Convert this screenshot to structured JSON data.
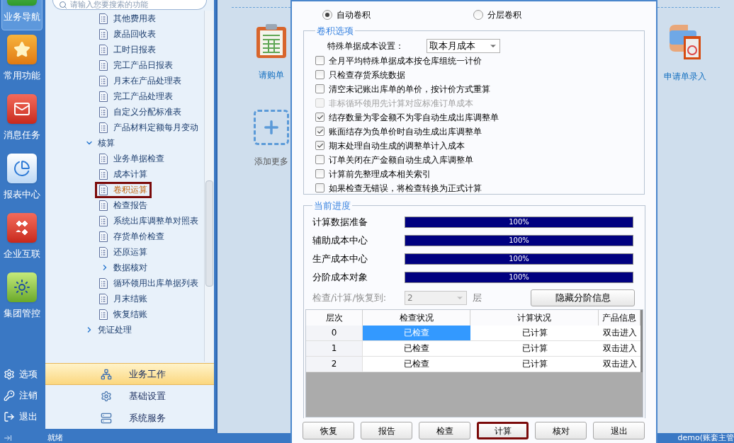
{
  "rail": {
    "items": [
      {
        "label": "业务导航",
        "selected": true,
        "kind": "nav"
      },
      {
        "label": "常用功能",
        "selected": false,
        "kind": "star"
      },
      {
        "label": "消息任务",
        "selected": false,
        "kind": "mail"
      },
      {
        "label": "报表中心",
        "selected": false,
        "kind": "report"
      },
      {
        "label": "企业互联",
        "selected": false,
        "kind": "diamond"
      },
      {
        "label": "集团管控",
        "selected": false,
        "kind": "sun"
      }
    ],
    "bottom": [
      {
        "label": "选项",
        "kind": "gear"
      },
      {
        "label": "注销",
        "kind": "key"
      },
      {
        "label": "退出",
        "kind": "exit"
      }
    ]
  },
  "search": {
    "placeholder": "请输入您要搜索的功能"
  },
  "tree": [
    {
      "kind": "group",
      "children": [
        {
          "kind": "leaf",
          "label": "其他费用表",
          "selected": false
        },
        {
          "kind": "leaf",
          "label": "废品回收表",
          "selected": false
        },
        {
          "kind": "leaf",
          "label": "工时日报表",
          "selected": false
        },
        {
          "kind": "leaf",
          "label": "完工产品日报表",
          "selected": false
        },
        {
          "kind": "leaf",
          "label": "月末在产品处理表",
          "selected": false
        },
        {
          "kind": "leaf",
          "label": "完工产品处理表",
          "selected": false
        },
        {
          "kind": "leaf",
          "label": "自定义分配标准表",
          "selected": false
        },
        {
          "kind": "leaf",
          "label": "产品材料定额每月变动",
          "selected": false
        }
      ]
    },
    {
      "kind": "folder",
      "label": "核算",
      "expanded": true,
      "children": [
        {
          "kind": "leaf",
          "label": "业务单据检查",
          "selected": false
        },
        {
          "kind": "leaf",
          "label": "成本计算",
          "selected": false
        },
        {
          "kind": "leaf",
          "label": "卷积运算",
          "selected": true
        },
        {
          "kind": "leaf",
          "label": "检查报告",
          "selected": false
        },
        {
          "kind": "leaf",
          "label": "系统出库调整单对照表",
          "selected": false
        },
        {
          "kind": "leaf",
          "label": "存货单价检查",
          "selected": false
        },
        {
          "kind": "leaf",
          "label": "还原运算",
          "selected": false
        },
        {
          "kind": "folder",
          "label": "数据核对",
          "expanded": false
        },
        {
          "kind": "leaf",
          "label": "循环领用出库单据列表",
          "selected": false
        },
        {
          "kind": "leaf",
          "label": "月末结账",
          "selected": false
        },
        {
          "kind": "leaf",
          "label": "恢复结账",
          "selected": false
        }
      ]
    },
    {
      "kind": "folder",
      "label": "凭证处理",
      "expanded": false
    }
  ],
  "nav_sections": [
    {
      "label": "业务工作",
      "selected": true,
      "kind": "work"
    },
    {
      "label": "基础设置",
      "selected": false,
      "kind": "gear"
    },
    {
      "label": "系统服务",
      "selected": false,
      "kind": "server"
    }
  ],
  "shortcuts": [
    {
      "label": "请购单",
      "kind": "clipboard"
    },
    {
      "label": "添加更多",
      "kind": "add"
    },
    {
      "label": "申请单录入",
      "kind": "hand"
    }
  ],
  "dialog": {
    "modes": [
      {
        "label": "自动卷积",
        "selected": true
      },
      {
        "label": "分层卷积",
        "selected": false
      }
    ],
    "options_group": {
      "title": "卷积选项",
      "setting_label": "特殊单据成本设置：",
      "setting_value": "取本月成本",
      "options": [
        {
          "label": "全月平均特殊单据成本按仓库组统一计价",
          "checked": false,
          "disabled": false
        },
        {
          "label": "只检查存货系统数据",
          "checked": false,
          "disabled": false
        },
        {
          "label": "清空未记账出库单的单价，按计价方式重算",
          "checked": false,
          "disabled": false
        },
        {
          "label": "非标循环领用先计算对应标准订单成本",
          "checked": false,
          "disabled": true
        },
        {
          "label": "结存数量为零金额不为零自动生成出库调整单",
          "checked": true,
          "disabled": false
        },
        {
          "label": "账面结存为负单价时自动生成出库调整单",
          "checked": true,
          "disabled": false
        },
        {
          "label": "期末处理自动生成的调整单计入成本",
          "checked": true,
          "disabled": false
        },
        {
          "label": "订单关闭在产金额自动生成入库调整单",
          "checked": false,
          "disabled": false
        },
        {
          "label": "计算前先整理成本相关索引",
          "checked": false,
          "disabled": false
        },
        {
          "label": "如果检查无错误，将检查转换为正式计算",
          "checked": false,
          "disabled": false
        }
      ]
    },
    "progress_group": {
      "title": "当前进度",
      "stages": [
        {
          "label": "计算数据准备",
          "level": 1,
          "reading": "100%"
        },
        {
          "label": "辅助成本中心",
          "level": 1,
          "reading": "100%"
        },
        {
          "label": "生产成本中心",
          "level": 1,
          "reading": "100%"
        },
        {
          "label": "分阶成本对象",
          "level": 1,
          "reading": "100%"
        }
      ],
      "level_label": "检查/计算/恢复到:",
      "level_value": "2",
      "level_unit": "层",
      "level_disabled": true,
      "toggle_button": "隐藏分阶信息"
    },
    "table": {
      "columns": [
        "层次",
        "检查状况",
        "计算状况",
        "产品信息"
      ],
      "rows": [
        {
          "cells": [
            "0",
            "已检查",
            "已计算",
            "双击进入"
          ],
          "selected": true
        },
        {
          "cells": [
            "1",
            "已检查",
            "已计算",
            "双击进入"
          ],
          "selected": false
        },
        {
          "cells": [
            "2",
            "已检查",
            "已计算",
            "双击进入"
          ],
          "selected": false
        }
      ]
    },
    "buttons": [
      {
        "label": "恢复",
        "highlighted": false
      },
      {
        "label": "报告",
        "highlighted": false
      },
      {
        "label": "检查",
        "highlighted": false
      },
      {
        "label": "计算",
        "highlighted": true
      },
      {
        "label": "核对",
        "highlighted": false
      },
      {
        "label": "退出",
        "highlighted": false
      }
    ]
  },
  "status_bar": {
    "text": "就绪",
    "user": "demo(账套主管"
  }
}
